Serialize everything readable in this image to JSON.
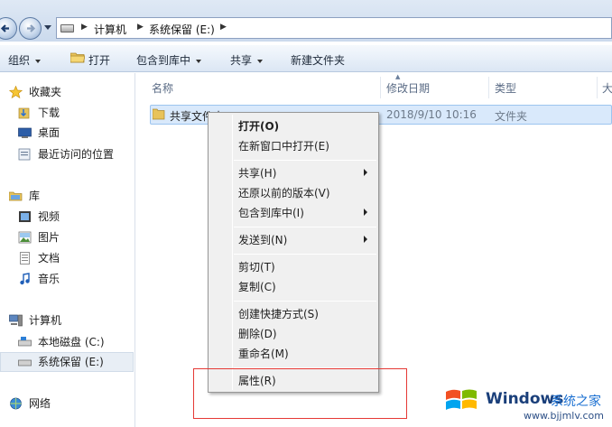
{
  "address": {
    "crumbs": [
      "计算机",
      "系统保留 (E:)"
    ]
  },
  "toolbar": {
    "organize": "组织",
    "open": "打开",
    "include_library": "包含到库中",
    "share": "共享",
    "new_folder": "新建文件夹"
  },
  "nav": {
    "favorites": "收藏夹",
    "downloads": "下载",
    "desktop": "桌面",
    "recent": "最近访问的位置",
    "libraries": "库",
    "videos": "视频",
    "pictures": "图片",
    "documents": "文档",
    "music": "音乐",
    "computer": "计算机",
    "local_disk": "本地磁盘 (C:)",
    "system_reserved": "系统保留 (E:)",
    "network": "网络"
  },
  "columns": {
    "name": "名称",
    "date": "修改日期",
    "type": "类型",
    "size": "大"
  },
  "file": {
    "name": "共享文件夹",
    "date": "2018/9/10 10:16",
    "type": "文件夹"
  },
  "menu": {
    "open": "打开(O)",
    "open_new_window": "在新窗口中打开(E)",
    "share": "共享(H)",
    "restore": "还原以前的版本(V)",
    "include": "包含到库中(I)",
    "send_to": "发送到(N)",
    "cut": "剪切(T)",
    "copy": "复制(C)",
    "create_shortcut": "创建快捷方式(S)",
    "delete": "删除(D)",
    "rename": "重命名(M)",
    "properties": "属性(R)"
  },
  "watermark": {
    "brand": "Windows",
    "suffix": "系统之家",
    "url": "www.bjjmlv.com"
  },
  "colors": {
    "highlight_box": "#e53935",
    "selection": "#d9e9fb"
  }
}
